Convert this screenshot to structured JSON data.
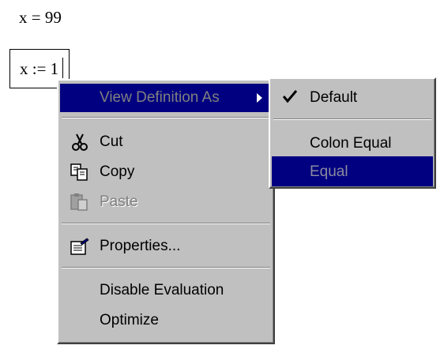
{
  "worksheet": {
    "eval_expr": "x = 99",
    "def_expr": "x := 1"
  },
  "context_menu": {
    "items": [
      {
        "label": "View Definition As",
        "icon": "none",
        "selected": true,
        "has_submenu": true
      },
      {
        "label": "Cut",
        "icon": "scissors-icon",
        "enabled": true
      },
      {
        "label": "Copy",
        "icon": "copy-icon",
        "enabled": true
      },
      {
        "label": "Paste",
        "icon": "paste-icon",
        "enabled": false
      },
      {
        "label": "Properties...",
        "icon": "properties-icon",
        "enabled": true
      },
      {
        "label": "Disable Evaluation",
        "icon": "none",
        "enabled": true
      },
      {
        "label": "Optimize",
        "icon": "none",
        "enabled": true
      }
    ]
  },
  "submenu": {
    "items": [
      {
        "label": "Default",
        "checked": true
      },
      {
        "label": "Colon Equal",
        "checked": false
      },
      {
        "label": "Equal",
        "checked": false,
        "highlighted": true
      }
    ]
  },
  "colors": {
    "menu_face": "#c0c0c0",
    "highlight": "#000080"
  }
}
